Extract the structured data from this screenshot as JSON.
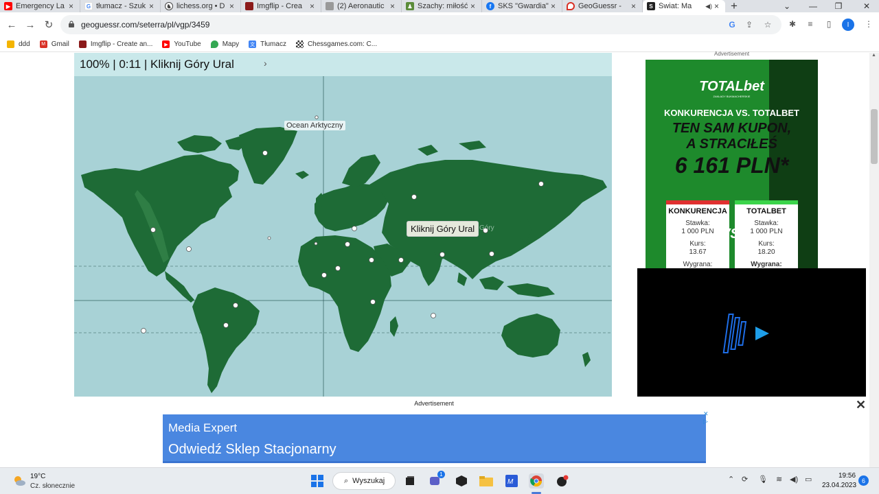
{
  "browser": {
    "tabs": [
      {
        "title": "Emergency La",
        "color": "#ff0000",
        "icon": "youtube-icon"
      },
      {
        "title": "tłumacz - Szuk",
        "color": "#4285f4",
        "icon": "google-icon"
      },
      {
        "title": "lichess.org • D",
        "color": "#444444",
        "icon": "lichess-icon"
      },
      {
        "title": "Imgflip - Crea",
        "color": "#8b1a1a",
        "icon": "imgflip-icon"
      },
      {
        "title": "(2) Aeronautic",
        "color": "#888888",
        "icon": "page-icon"
      },
      {
        "title": "Szachy: miłość",
        "color": "#5b8c3a",
        "icon": "chess-icon"
      },
      {
        "title": "SKS \"Gwardia\"",
        "color": "#1877f2",
        "icon": "facebook-icon"
      },
      {
        "title": "GeoGuessr - ",
        "color": "#d93025",
        "icon": "map-pin-icon"
      },
      {
        "title": "Świat: Ma",
        "color": "#222222",
        "icon": "seterra-icon",
        "active": true
      }
    ],
    "url": "geoguessr.com/seterra/pl/vgp/3459",
    "bookmarks": [
      {
        "label": "ddd",
        "color": "#f4b400",
        "icon": "folder-icon"
      },
      {
        "label": "Gmail",
        "color": "#d93025",
        "icon": "gmail-icon"
      },
      {
        "label": "Imgflip - Create an...",
        "color": "#8b1a1a",
        "icon": "imgflip-icon"
      },
      {
        "label": "YouTube",
        "color": "#ff0000",
        "icon": "youtube-icon"
      },
      {
        "label": "Mapy",
        "color": "#34a853",
        "icon": "maps-icon"
      },
      {
        "label": "Tłumacz",
        "color": "#4285f4",
        "icon": "translate-icon"
      },
      {
        "label": "Chessgames.com: C...",
        "color": "#333333",
        "icon": "chessgames-icon"
      }
    ],
    "profile_initial": "I"
  },
  "game": {
    "status": "100% | 0:11 | Kliknij Góry Ural",
    "ocean_label": "Ocean Arktyczny",
    "prompt": "Kliknij Góry Ural",
    "colors": {
      "ocean": "#a8d2d6",
      "land": "#1e6b36",
      "header": "#c9e8ea"
    }
  },
  "ads": {
    "top_label": "Advertisement",
    "totalbet": {
      "logo": "TOTALbet",
      "logo_sub": "ZAKŁADY BUKMACHERSKIE",
      "line1": "KONKURENCJA VS. TOTALBET",
      "line2": "TEN SAM KUPON,",
      "line3": "A STRACIŁEŚ",
      "line4": "6 161 PLN*",
      "vs": "VS.",
      "left": {
        "name": "KONKURENCJA",
        "stake_label": "Stawka:",
        "stake": "1 000 PLN",
        "odds_label": "Kurs:",
        "odds": "13.67",
        "win_label": "Wygrana:"
      },
      "right": {
        "name": "TOTALBET",
        "stake_label": "Stawka:",
        "stake": "1 000 PLN",
        "odds_label": "Kurs:",
        "odds": "18.20",
        "win_label": "Wygrana:"
      }
    },
    "bottom_label": "Advertisement",
    "bottom_line1": "Media Expert",
    "bottom_line2": "Odwiedź Sklep Stacjonarny"
  },
  "taskbar": {
    "temp": "19°C",
    "weather": "Cz. słonecznie",
    "search": "Wyszukaj",
    "time": "19:56",
    "date": "23.04.2023",
    "notifications": "6",
    "teams_badge": "1"
  }
}
